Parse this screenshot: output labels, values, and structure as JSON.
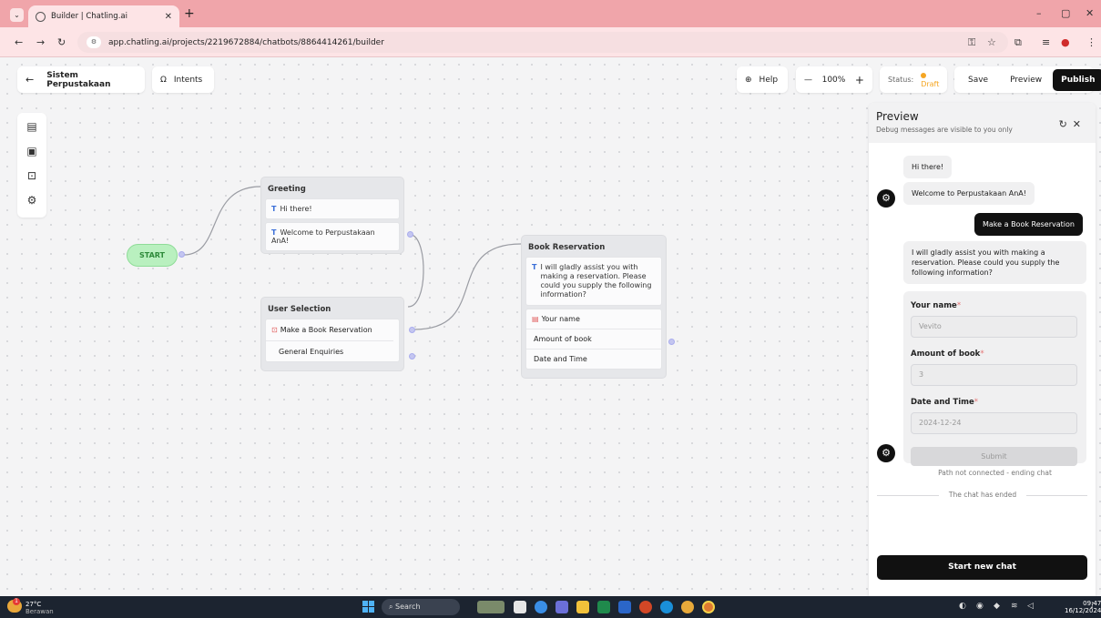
{
  "browser": {
    "tab_title": "Builder | Chatling.ai",
    "url": "app.chatling.ai/projects/2219672884/chatbots/8864414261/builder",
    "window_minimize": "–",
    "window_restore": "▢",
    "window_close": "✕"
  },
  "toolbar": {
    "back_arrow": "←",
    "project_name": "Sistem Perpustakaan",
    "intents_label": "Intents",
    "help_label": "Help",
    "zoom_out": "—",
    "zoom_level": "100%",
    "zoom_in": "+",
    "status_label": "Status:",
    "status_value": "Draft",
    "save_label": "Save",
    "preview_label": "Preview",
    "publish_label": "Publish"
  },
  "canvas": {
    "start_label": "START",
    "nodes": {
      "greeting": {
        "title": "Greeting",
        "items": [
          "Hi there!",
          "Welcome to Perpustakaan AnA!"
        ]
      },
      "user_selection": {
        "title": "User Selection",
        "items": [
          "Make a Book Reservation",
          "General Enquiries"
        ]
      },
      "book_reservation": {
        "title": "Book Reservation",
        "message": "I will gladly assist you with making a reservation. Please could you supply the following information?",
        "fields": [
          "Your name",
          "Amount of book",
          "Date and Time"
        ]
      }
    },
    "text_marker": "T"
  },
  "preview": {
    "title": "Preview",
    "subtitle": "Debug messages are visible to you only",
    "messages": {
      "bot_1": "Hi there!",
      "bot_2": "Welcome to Perpustakaan AnA!",
      "user_1": "Make a Book Reservation",
      "bot_3": "I will gladly assist you with making a reservation. Please could you supply the following information?"
    },
    "form": {
      "name_label": "Your name",
      "name_value": "Vevito",
      "amount_label": "Amount of book",
      "amount_value": "3",
      "date_label": "Date and Time",
      "date_value": "2024-12-24",
      "required_mark": "*",
      "submit_label": "Submit"
    },
    "path_note": "Path not connected - ending chat",
    "ended_note": "The chat has ended",
    "start_new_label": "Start new chat"
  },
  "taskbar": {
    "temperature": "27°C",
    "weather": "Berawan",
    "weather_badge": "1",
    "search_label": "Search",
    "time": "09:47",
    "date": "16/12/2024"
  },
  "colors": {
    "tabbar": "#f0a5aa",
    "draft": "#f5a623",
    "start_node": "#b9f0bf",
    "dark_button": "#111111",
    "port": "#c4c6f0"
  }
}
